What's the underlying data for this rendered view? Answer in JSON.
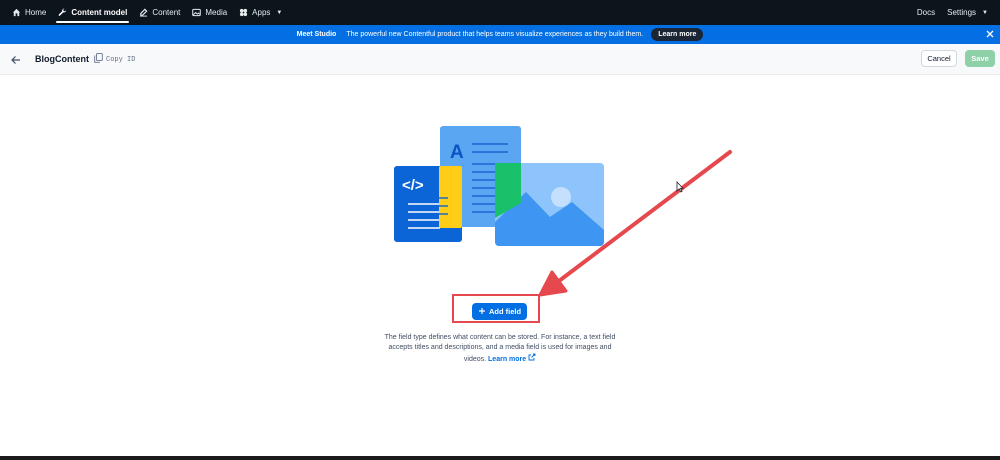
{
  "topnav": {
    "items": [
      {
        "label": "Home",
        "icon": "home-icon",
        "active": false
      },
      {
        "label": "Content model",
        "icon": "wrench-icon",
        "active": true
      },
      {
        "label": "Content",
        "icon": "content-icon",
        "active": false
      },
      {
        "label": "Media",
        "icon": "image-icon",
        "active": false
      },
      {
        "label": "Apps",
        "icon": "apps-icon",
        "active": false
      }
    ],
    "docs": "Docs",
    "settings": "Settings"
  },
  "banner": {
    "title": "Meet Studio",
    "text": "The powerful new Contentful product that helps teams visualize experiences as they build them.",
    "button": "Learn more",
    "close_icon": "close-icon"
  },
  "header": {
    "content_type_name": "BlogContent",
    "copy_id_label": "Copy ID",
    "cancel_label": "Cancel",
    "save_label": "Save"
  },
  "main": {
    "add_field_label": "Add field",
    "help_text": "The field type defines what content can be stored. For instance, a text field accepts titles and descriptions, and a media field is used for images and videos.",
    "learn_more": "Learn more",
    "illustration_letter": "A",
    "illustration_code": "</>"
  },
  "colors": {
    "nav_bg": "#0c141c",
    "banner_bg": "#036fe3",
    "primary": "#036fe3",
    "save_disabled": "#8ed0a8",
    "annotation_red": "#e5484d"
  }
}
